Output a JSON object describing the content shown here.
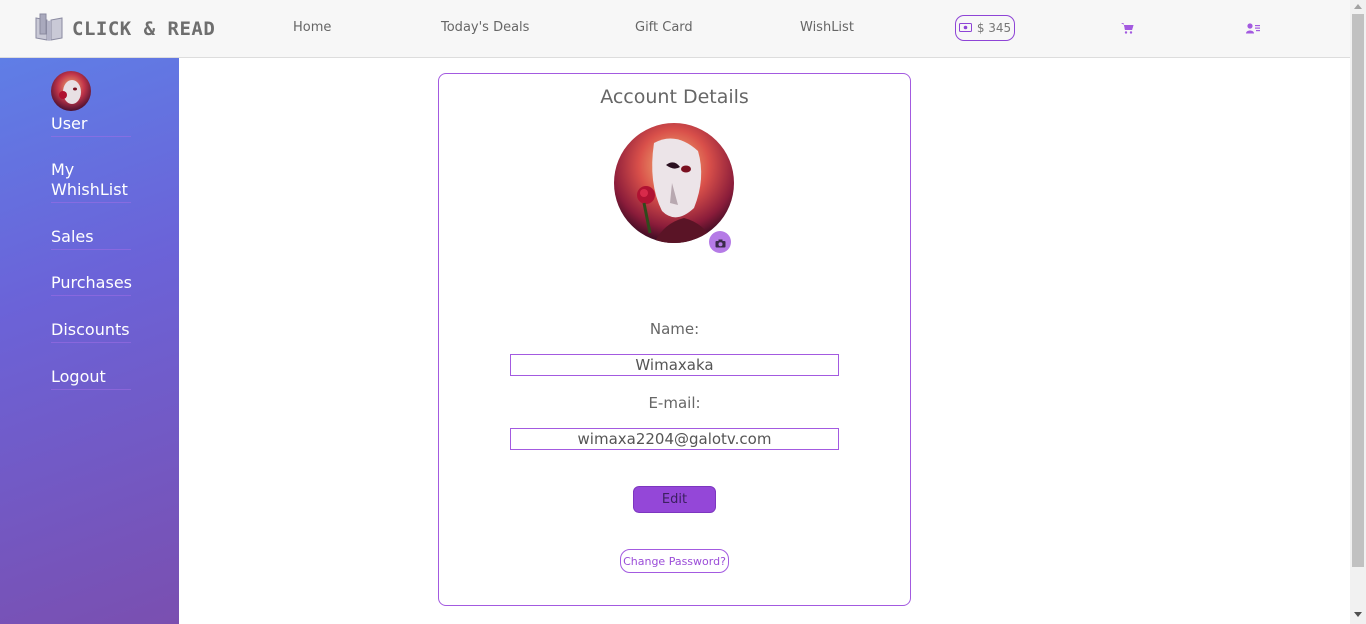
{
  "header": {
    "logo_text": "CLICK & READ",
    "nav": [
      "Home",
      "Today's Deals",
      "Gift Card",
      "WishList"
    ],
    "balance": "$ 345"
  },
  "sidebar": {
    "items": [
      "User",
      "My WhishList",
      "Sales",
      "Purchases",
      "Discounts",
      "Logout"
    ]
  },
  "account": {
    "title": "Account Details",
    "name_label": "Name:",
    "name_value": "Wimaxaka",
    "email_label": "E-mail:",
    "email_value": "wimaxa2204@galotv.com",
    "edit_label": "Edit",
    "change_password_label": "Change Password?"
  },
  "icons": {
    "logo": "open-book-icon",
    "balance": "money-icon",
    "cart": "cart-icon",
    "profile": "user-list-icon",
    "camera": "camera-icon"
  },
  "colors": {
    "accent": "#9447d8",
    "sidebar_top": "#5f7ee6",
    "sidebar_bottom": "#7a4fb0"
  }
}
